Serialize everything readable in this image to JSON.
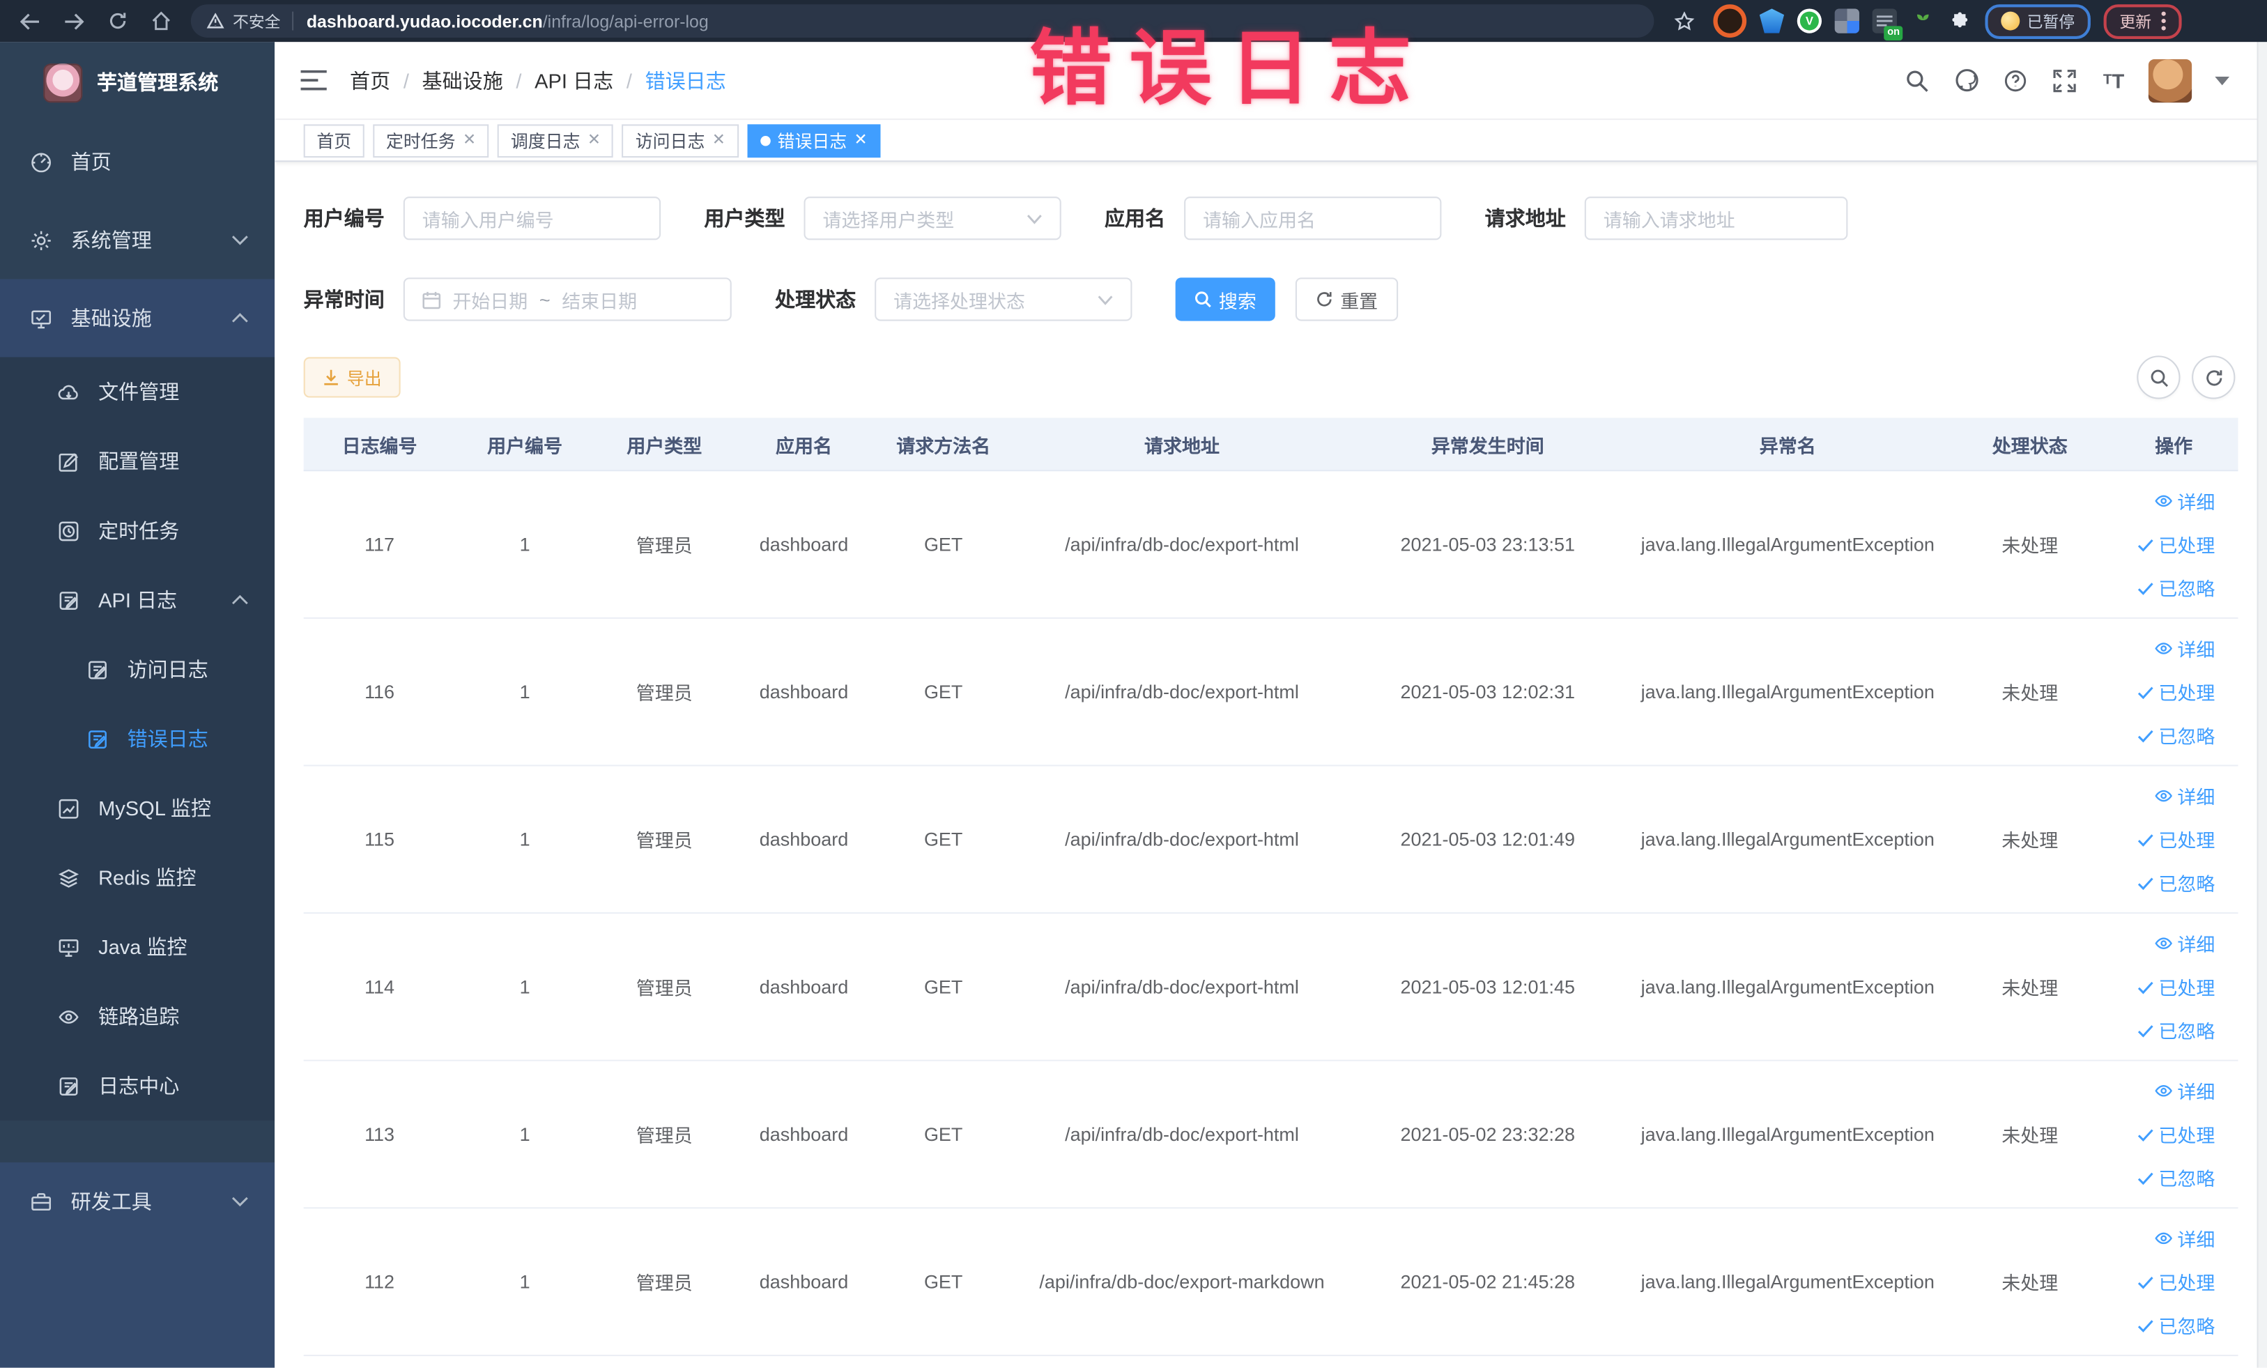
{
  "annotation": {
    "text": "错误日志"
  },
  "browser": {
    "security_label": "不安全",
    "url_domain": "dashboard.yudao.iocoder.cn",
    "url_path": "/infra/log/api-error-log",
    "on_badge": "on",
    "paused_badge": "已暂停",
    "update_badge": "更新"
  },
  "sidebar": {
    "title": "芋道管理系统",
    "items": [
      {
        "key": "home",
        "label": "首页",
        "icon": "gauge",
        "level": 1
      },
      {
        "key": "system",
        "label": "系统管理",
        "icon": "gear",
        "level": 1,
        "chevron": "down"
      },
      {
        "key": "infra",
        "label": "基础设施",
        "icon": "screen",
        "level": 1,
        "chevron": "up",
        "highlight": true
      },
      {
        "key": "file",
        "label": "文件管理",
        "icon": "cloud",
        "level": 2
      },
      {
        "key": "config",
        "label": "配置管理",
        "icon": "edit",
        "level": 2
      },
      {
        "key": "job",
        "label": "定时任务",
        "icon": "clock",
        "level": 2
      },
      {
        "key": "api-log",
        "label": "API 日志",
        "icon": "doc",
        "level": 2,
        "chevron": "up"
      },
      {
        "key": "access-log",
        "label": "访问日志",
        "icon": "doc",
        "level": 3
      },
      {
        "key": "error-log",
        "label": "错误日志",
        "icon": "doc",
        "level": 3,
        "active": true
      },
      {
        "key": "mysql",
        "label": "MySQL 监控",
        "icon": "chart",
        "level": 2
      },
      {
        "key": "redis",
        "label": "Redis 监控",
        "icon": "layers",
        "level": 2
      },
      {
        "key": "java",
        "label": "Java 监控",
        "icon": "monitor",
        "level": 2
      },
      {
        "key": "trace",
        "label": "链路追踪",
        "icon": "eye",
        "level": 2
      },
      {
        "key": "log-center",
        "label": "日志中心",
        "icon": "doc",
        "level": 2
      },
      {
        "key": "devtools",
        "label": "研发工具",
        "icon": "case",
        "level": 1,
        "chevron": "down",
        "section": "dev"
      }
    ]
  },
  "header": {
    "breadcrumb": [
      {
        "label": "首页"
      },
      {
        "label": "基础设施"
      },
      {
        "label": "API 日志"
      },
      {
        "label": "错误日志",
        "active": true
      }
    ]
  },
  "tabs": [
    {
      "label": "首页",
      "closable": false,
      "active": false
    },
    {
      "label": "定时任务",
      "closable": true,
      "active": false
    },
    {
      "label": "调度日志",
      "closable": true,
      "active": false
    },
    {
      "label": "访问日志",
      "closable": true,
      "active": false
    },
    {
      "label": "错误日志",
      "closable": true,
      "active": true
    }
  ],
  "filters": {
    "user_id": {
      "label": "用户编号",
      "placeholder": "请输入用户编号"
    },
    "user_type": {
      "label": "用户类型",
      "placeholder": "请选择用户类型"
    },
    "app_name": {
      "label": "应用名",
      "placeholder": "请输入应用名"
    },
    "request_url": {
      "label": "请求地址",
      "placeholder": "请输入请求地址"
    },
    "exception_time": {
      "label": "异常时间",
      "start_placeholder": "开始日期",
      "separator": "~",
      "end_placeholder": "结束日期"
    },
    "process_status": {
      "label": "处理状态",
      "placeholder": "请选择处理状态"
    },
    "search_label": "搜索",
    "reset_label": "重置"
  },
  "toolbar": {
    "export_label": "导出"
  },
  "table": {
    "columns": [
      "日志编号",
      "用户编号",
      "用户类型",
      "应用名",
      "请求方法名",
      "请求地址",
      "异常发生时间",
      "异常名",
      "处理状态",
      "操作"
    ],
    "actions": [
      "详细",
      "已处理",
      "已忽略"
    ],
    "rows": [
      {
        "id": "117",
        "user_id": "1",
        "user_type": "管理员",
        "app": "dashboard",
        "method": "GET",
        "url": "/api/infra/db-doc/export-html",
        "time": "2021-05-03 23:13:51",
        "exception": "java.lang.IllegalArgumentException",
        "status": "未处理"
      },
      {
        "id": "116",
        "user_id": "1",
        "user_type": "管理员",
        "app": "dashboard",
        "method": "GET",
        "url": "/api/infra/db-doc/export-html",
        "time": "2021-05-03 12:02:31",
        "exception": "java.lang.IllegalArgumentException",
        "status": "未处理"
      },
      {
        "id": "115",
        "user_id": "1",
        "user_type": "管理员",
        "app": "dashboard",
        "method": "GET",
        "url": "/api/infra/db-doc/export-html",
        "time": "2021-05-03 12:01:49",
        "exception": "java.lang.IllegalArgumentException",
        "status": "未处理"
      },
      {
        "id": "114",
        "user_id": "1",
        "user_type": "管理员",
        "app": "dashboard",
        "method": "GET",
        "url": "/api/infra/db-doc/export-html",
        "time": "2021-05-03 12:01:45",
        "exception": "java.lang.IllegalArgumentException",
        "status": "未处理"
      },
      {
        "id": "113",
        "user_id": "1",
        "user_type": "管理员",
        "app": "dashboard",
        "method": "GET",
        "url": "/api/infra/db-doc/export-html",
        "time": "2021-05-02 23:32:28",
        "exception": "java.lang.IllegalArgumentException",
        "status": "未处理"
      },
      {
        "id": "112",
        "user_id": "1",
        "user_type": "管理员",
        "app": "dashboard",
        "method": "GET",
        "url": "/api/infra/db-doc/export-markdown",
        "time": "2021-05-02 21:45:28",
        "exception": "java.lang.IllegalArgumentException",
        "status": "未处理"
      }
    ]
  },
  "colors": {
    "accent": "#409eff",
    "warning": "#e6a23c",
    "annotation": "#f23a5e",
    "sidebar_bg": "#2e4156"
  }
}
